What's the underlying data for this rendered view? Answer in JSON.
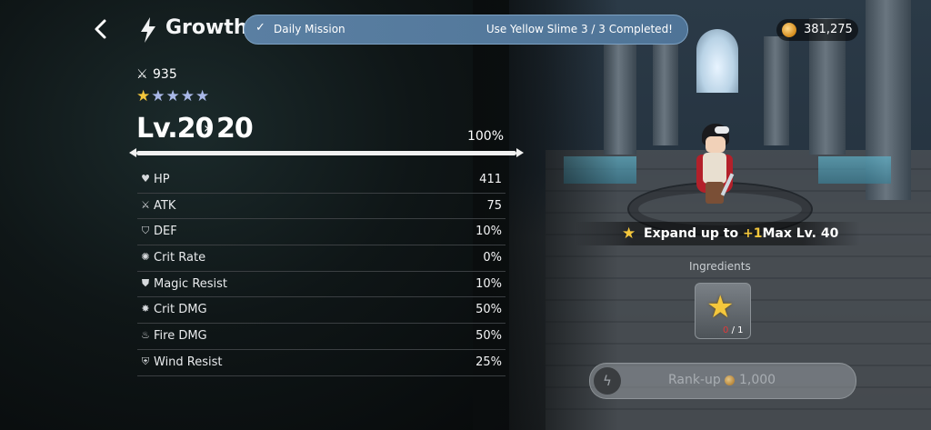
{
  "header": {
    "back_icon": "chevron-left-icon",
    "growth_icon": "lightning-icon",
    "title": "Growth"
  },
  "mission": {
    "label": "Daily Mission",
    "status": "Use Yellow Slime 3 / 3 Completed!"
  },
  "currency": {
    "icon": "gold-coin-icon",
    "amount": "381,275"
  },
  "character": {
    "power": "935",
    "stars_total": 5,
    "stars_filled": 1,
    "level_prefix": "Lv.",
    "level_current": "20",
    "level_target": "20",
    "exp_percent": "100%"
  },
  "stats": [
    {
      "icon": "heart-icon",
      "label": "HP",
      "value": "411"
    },
    {
      "icon": "sword-icon",
      "label": "ATK",
      "value": "75"
    },
    {
      "icon": "shield-icon",
      "label": "DEF",
      "value": "10%"
    },
    {
      "icon": "crit-icon",
      "label": "Crit Rate",
      "value": "0%"
    },
    {
      "icon": "magic-shield-icon",
      "label": "Magic Resist",
      "value": "10%"
    },
    {
      "icon": "crit-burst-icon",
      "label": "Crit DMG",
      "value": "50%"
    },
    {
      "icon": "fire-icon",
      "label": "Fire DMG",
      "value": "50%"
    },
    {
      "icon": "wind-shield-icon",
      "label": "Wind Resist",
      "value": "25%"
    }
  ],
  "expand": {
    "prefix": "Expand up to ",
    "plus": "+1",
    "suffix": "Max Lv. 40"
  },
  "ingredients": {
    "label": "Ingredients",
    "item_icon": "star-icon",
    "have": "0",
    "need": "/ 1"
  },
  "rankup": {
    "label": "Rank-up",
    "cost": "1,000"
  },
  "colors": {
    "gold": "#f4c73c",
    "mission_bg": "#5a7fa2",
    "insufficient": "#e0393a"
  }
}
